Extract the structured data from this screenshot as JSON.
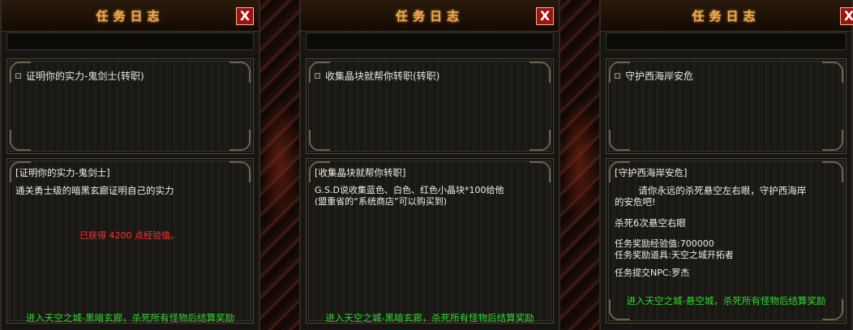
{
  "panels": [
    {
      "title": "任务日志",
      "close_label": "X",
      "quest_item": "证明你的实力-鬼剑士(转职)",
      "detail_title": "[证明你的实力-鬼剑士]",
      "detail_desc": "通关勇士级的暗黑玄廊证明自己的实力",
      "reward_text": "已获得 4200 点经验值。",
      "footer": "进入天空之城-黑暗玄廊，杀死所有怪物后结算奖励"
    },
    {
      "title": "任务日志",
      "close_label": "X",
      "quest_item": "收集晶块就帮你转职(转职)",
      "detail_title": "[收集晶块就帮你转职]",
      "detail_line1": "G.S.D说收集蓝色、白色、红色小晶块*100给他",
      "detail_line2": "(盟重省的“系统商店”可以购买到)",
      "footer": "进入天空之城-黑暗玄廊，杀死所有怪物后结算奖励"
    },
    {
      "title": "任务日志",
      "close_label": "X",
      "quest_item": "守护西海岸安危",
      "detail_title": "[守护西海岸安危]",
      "detail_line1": "        请你永远的杀死悬空左右眼，守护西海岸",
      "detail_line2": "的安危吧!",
      "kill_target": "杀死6次悬空右眼",
      "reward_exp": "任务奖励经验值:700000",
      "reward_item": "任务奖励道具:天空之城开拓者",
      "submit_npc": "任务提交NPC:罗杰",
      "footer": "进入天空之城-悬空城，杀死所有怪物后结算奖励"
    }
  ]
}
